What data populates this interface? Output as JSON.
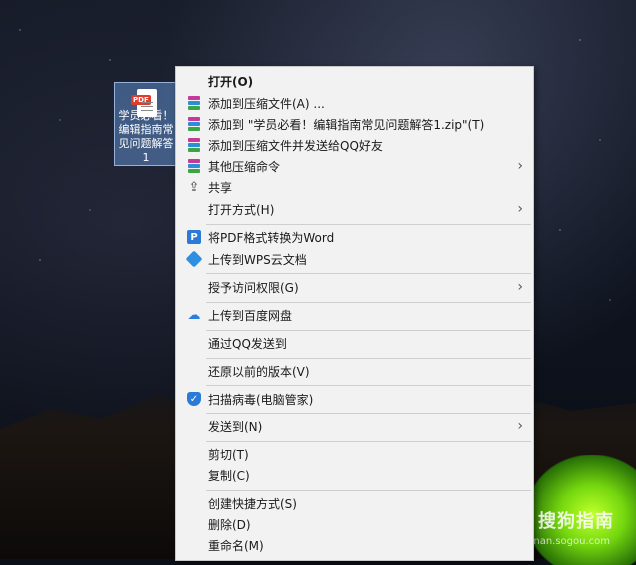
{
  "desktop": {
    "file_label": "学员必看！编辑指南常见问题解答1",
    "file_type_tag": "PDF",
    "watermark": "搜狗指南",
    "watermark_sub": "zhinan.sogou.com"
  },
  "menu": {
    "items": [
      {
        "label": "打开(O)",
        "icon": "none"
      },
      {
        "label": "添加到压缩文件(A) ...",
        "icon": "winrar-icon"
      },
      {
        "label": "添加到 \"学员必看！编辑指南常见问题解答1.zip\"(T)",
        "icon": "winrar-icon"
      },
      {
        "label": "添加到压缩文件并发送给QQ好友",
        "icon": "winrar-icon"
      },
      {
        "label": "其他压缩命令",
        "icon": "winrar-icon",
        "submenu": true
      },
      {
        "label": "共享",
        "icon": "share-icon"
      },
      {
        "label": "打开方式(H)",
        "icon": "none",
        "submenu": true
      },
      {
        "label": "将PDF格式转换为Word",
        "icon": "pdf-convert-icon"
      },
      {
        "label": "上传到WPS云文档",
        "icon": "wps-cloud-icon"
      },
      {
        "label": "授予访问权限(G)",
        "icon": "none",
        "submenu": true
      },
      {
        "label": "上传到百度网盘",
        "icon": "baidu-netdisk-icon"
      },
      {
        "label": "通过QQ发送到",
        "icon": "none"
      },
      {
        "label": "还原以前的版本(V)",
        "icon": "none"
      },
      {
        "label": "扫描病毒(电脑管家)",
        "icon": "shield-icon"
      },
      {
        "label": "发送到(N)",
        "icon": "none",
        "submenu": true
      },
      {
        "label": "剪切(T)",
        "icon": "none"
      },
      {
        "label": "复制(C)",
        "icon": "none"
      },
      {
        "label": "创建快捷方式(S)",
        "icon": "none"
      },
      {
        "label": "删除(D)",
        "icon": "none"
      },
      {
        "label": "重命名(M)",
        "icon": "none"
      }
    ],
    "submenu_arrow": "›"
  },
  "colors": {
    "menu_bg": "#f2f2f2",
    "separator": "#cfcfcf",
    "accent_blue": "#2a7ad6"
  }
}
